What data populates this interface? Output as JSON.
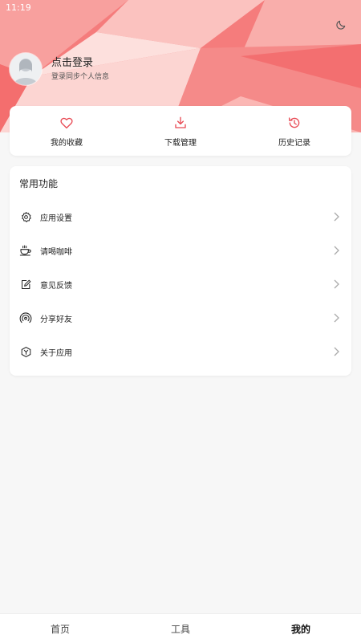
{
  "status_bar": {
    "time": "11:19"
  },
  "profile": {
    "title": "点击登录",
    "subtitle": "登录同步个人信息"
  },
  "quick_actions": [
    {
      "label": "我的收藏",
      "icon": "heart-icon"
    },
    {
      "label": "下载管理",
      "icon": "download-icon"
    },
    {
      "label": "历史记录",
      "icon": "history-icon"
    }
  ],
  "functions": {
    "title": "常用功能",
    "items": [
      {
        "label": "应用设置",
        "icon": "gear-icon"
      },
      {
        "label": "请喝咖啡",
        "icon": "coffee-icon"
      },
      {
        "label": "意见反馈",
        "icon": "feedback-icon"
      },
      {
        "label": "分享好友",
        "icon": "share-icon"
      },
      {
        "label": "关于应用",
        "icon": "about-icon"
      }
    ]
  },
  "bottom_nav": [
    {
      "label": "首页",
      "active": false
    },
    {
      "label": "工具",
      "active": false
    },
    {
      "label": "我的",
      "active": true
    }
  ],
  "colors": {
    "accent": "#e84b55",
    "header": "#f7777a",
    "page_background": "#f7f7f7"
  }
}
